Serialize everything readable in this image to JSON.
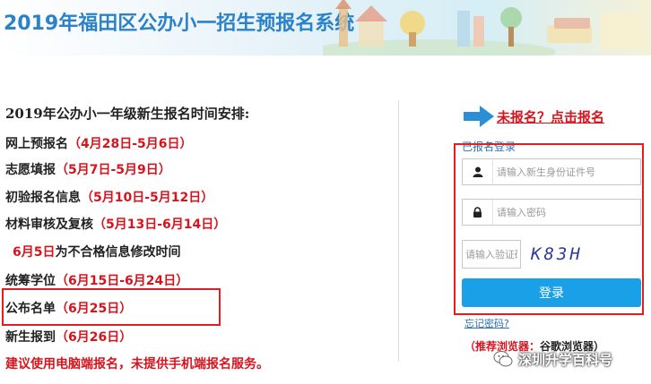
{
  "header": {
    "title": "2019年福田区公办小一招生预报名系统"
  },
  "schedule": {
    "title": "2019年公办小一年级新生报名时间安排:",
    "rows": [
      {
        "label": "网上预报名",
        "date": "（4月28日-5月6日）"
      },
      {
        "label": "志愿填报",
        "date": "（5月7日-5月9日）"
      },
      {
        "label": "初验报名信息",
        "date": "（5月10日-5月12日）"
      },
      {
        "label": "材料审核及复核",
        "date": "（5月13日-6月14日）"
      },
      {
        "label": "为不合格信息修改时间",
        "date": "6月5日"
      },
      {
        "label": "统筹学位",
        "date": "（6月15日-6月24日）"
      },
      {
        "label": "公布名单",
        "date": "（6月25日）"
      },
      {
        "label": "新生报到",
        "date": "（6月26日）"
      }
    ],
    "notice": "建议使用电脑端报名，未提供手机端报名服务。"
  },
  "login": {
    "register_link": "未报名？点击报名",
    "already_label": "已报名登录",
    "id_placeholder": "请输入新生身份证件号",
    "password_placeholder": "请输入密码",
    "captcha_placeholder": "请输入验证码",
    "captcha_text": "K83H",
    "login_button": "登录",
    "forgot_link": "忘记密码?",
    "browser_prefix": "（推荐浏览器：",
    "browser_text": "谷歌浏览器）"
  },
  "watermark": {
    "text": "深圳升学百科号"
  },
  "icons": {
    "arrow": "right-arrow-icon",
    "user": "user-icon",
    "lock": "lock-icon",
    "wechat": "wechat-icon"
  },
  "colors": {
    "brand_blue": "#2b82c9",
    "highlight_red": "#d6141e",
    "button_blue": "#1aa0e6",
    "box_red": "#e02020"
  }
}
